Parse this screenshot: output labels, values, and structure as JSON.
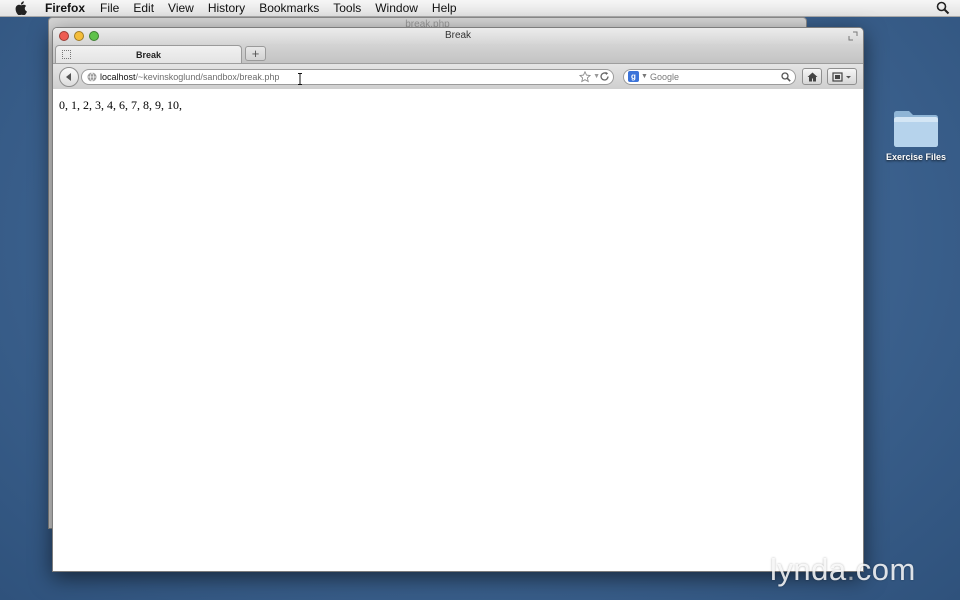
{
  "menubar": {
    "app_name": "Firefox",
    "items": [
      "File",
      "Edit",
      "View",
      "History",
      "Bookmarks",
      "Tools",
      "Window",
      "Help"
    ]
  },
  "back_window": {
    "title": "break.php"
  },
  "window": {
    "title": "Break",
    "tab": {
      "label": "Break"
    },
    "url": {
      "host": "localhost",
      "path": "/~kevinskoglund/sandbox/break.php"
    },
    "search": {
      "engine_icon": "google-icon",
      "placeholder": "Google"
    },
    "page_output": "0, 1, 2, 3, 4, 6, 7, 8, 9, 10,"
  },
  "desktop": {
    "folder_label": "Exercise Files"
  },
  "watermark": {
    "brand": "lynda",
    "dot": ".",
    "tld": "com"
  },
  "colors": {
    "desktop": "#3c628f",
    "close": "#ee5c52",
    "minimize": "#f4bd3a",
    "zoom": "#5fc24a"
  }
}
